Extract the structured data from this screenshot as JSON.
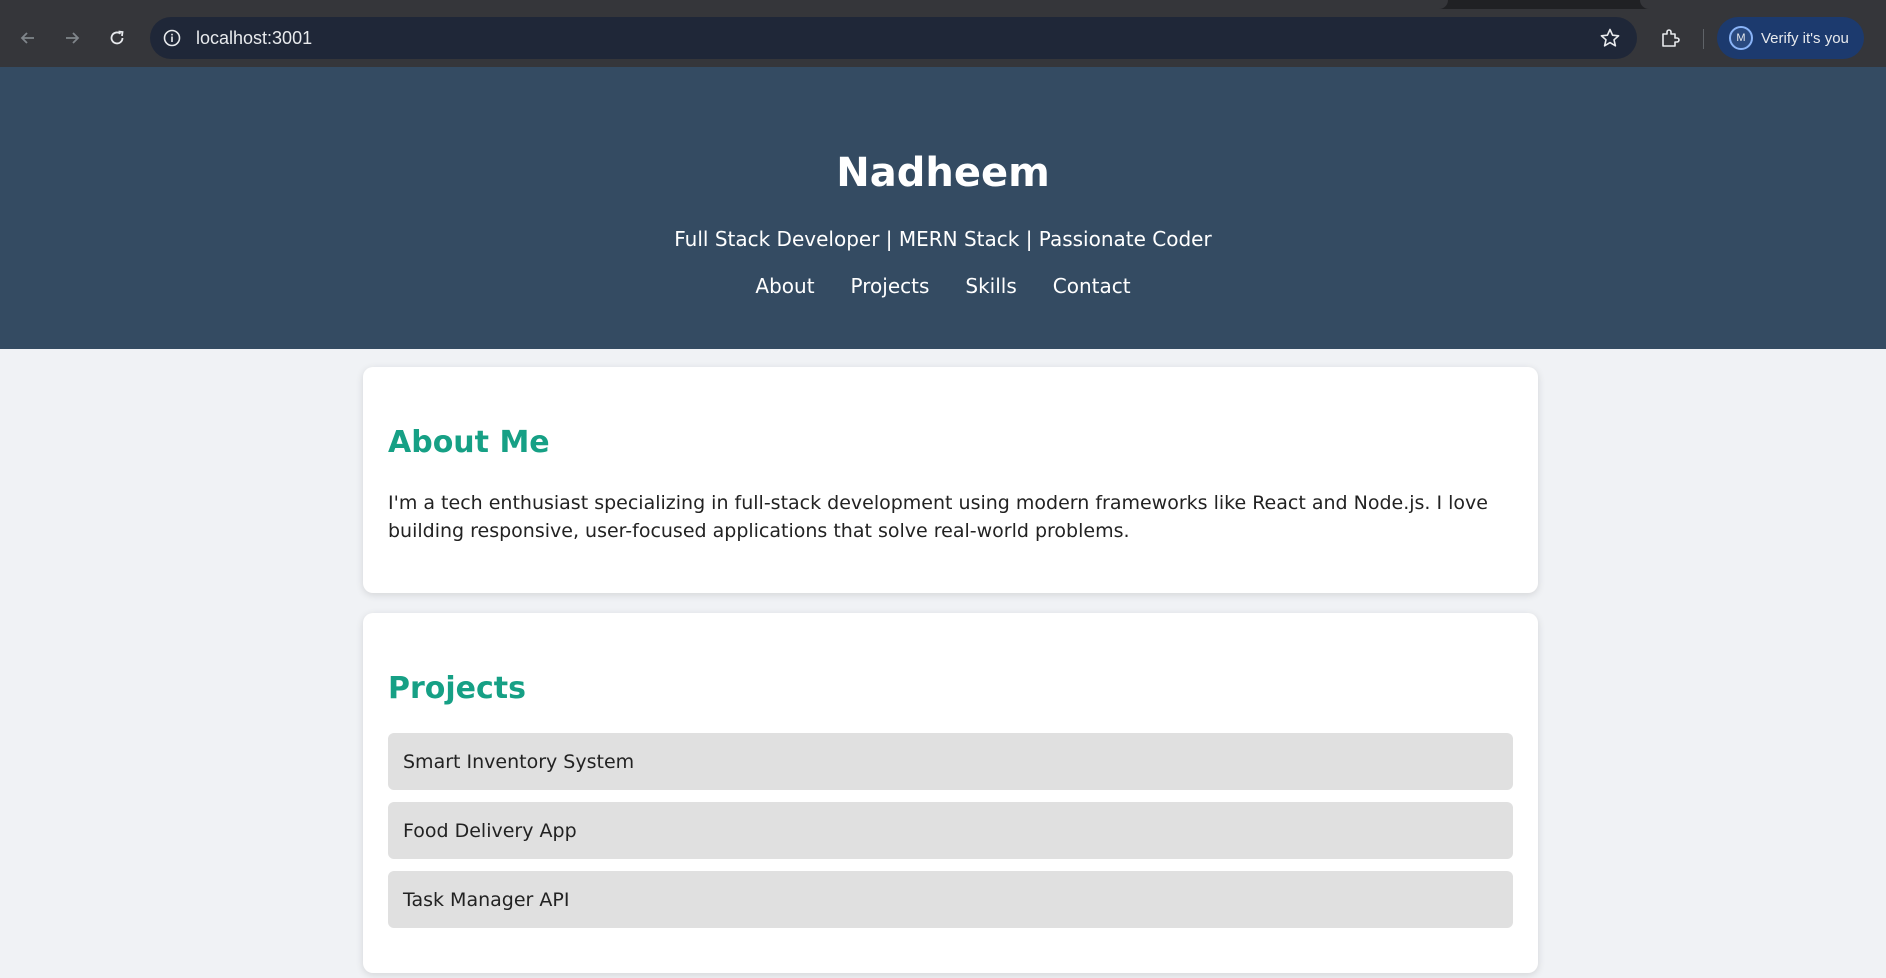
{
  "browser": {
    "url": "localhost:3001",
    "verify_label": "Verify it's you",
    "avatar_initial": "M",
    "icons": [
      "back-icon",
      "forward-icon",
      "reload-icon",
      "info-icon",
      "star-icon",
      "extensions-icon"
    ]
  },
  "header": {
    "title": "Nadheem",
    "subtitle": "Full Stack Developer | MERN Stack | Passionate Coder",
    "nav": [
      "About",
      "Projects",
      "Skills",
      "Contact"
    ]
  },
  "about": {
    "heading": "About Me",
    "text": "I'm a tech enthusiast specializing in full-stack development using modern frameworks like React and Node.js. I love building responsive, user-focused applications that solve real-world problems."
  },
  "projects": {
    "heading": "Projects",
    "items": [
      "Smart Inventory System",
      "Food Delivery App",
      "Task Manager API"
    ]
  },
  "colors": {
    "header_bg": "#344b62",
    "accent": "#16a085",
    "page_bg": "#f0f2f5",
    "project_bg": "#e0e0e0"
  }
}
